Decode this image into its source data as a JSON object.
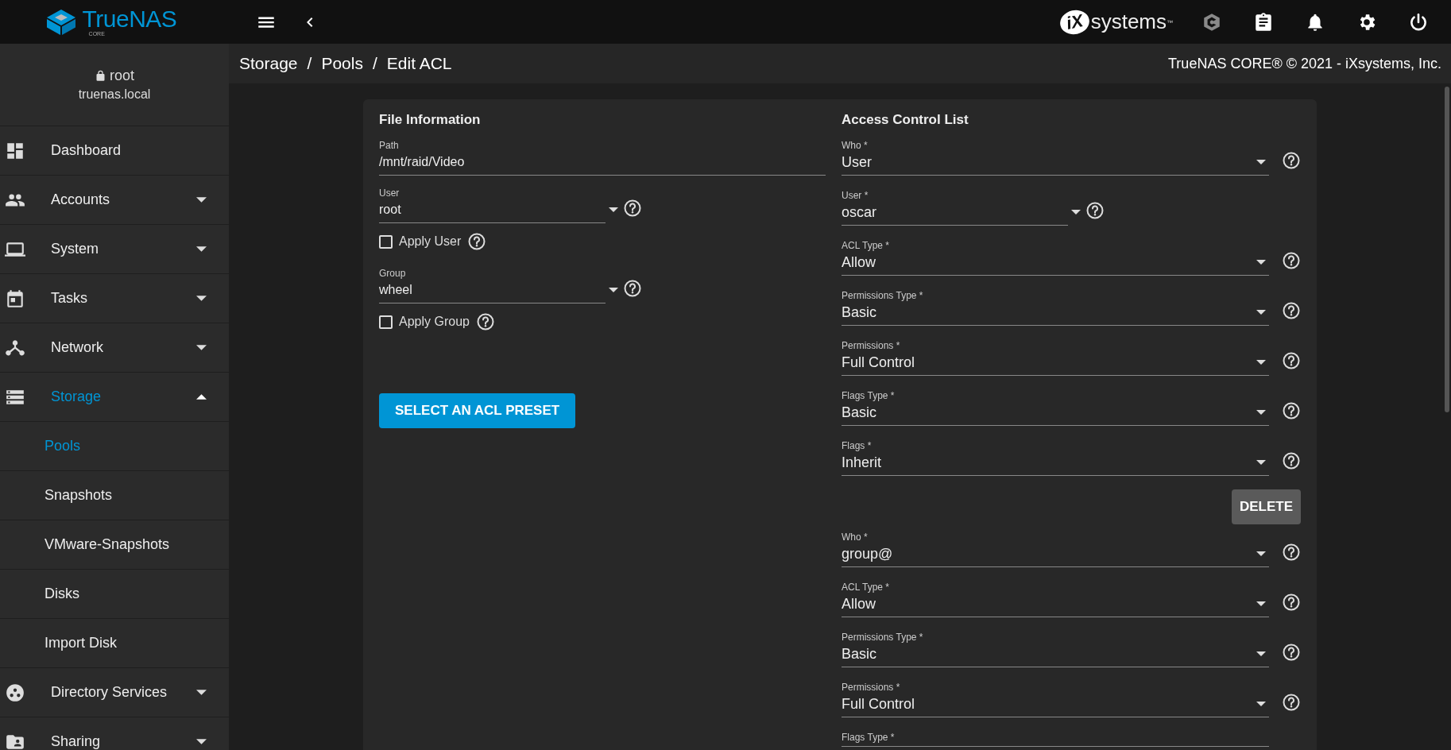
{
  "topbar": {
    "logo_name": "TrueNAS",
    "logo_sub": "CORE",
    "vendor_mark": "iX",
    "vendor_name": "systems",
    "vendor_tm": "™"
  },
  "sidebar": {
    "user": "root",
    "host": "truenas.local",
    "items": [
      {
        "label": "Dashboard",
        "selected": false
      },
      {
        "label": "Accounts",
        "selected": false,
        "expanded": false
      },
      {
        "label": "System",
        "selected": false,
        "expanded": false
      },
      {
        "label": "Tasks",
        "selected": false,
        "expanded": false
      },
      {
        "label": "Network",
        "selected": false,
        "expanded": false
      },
      {
        "label": "Storage",
        "selected": true,
        "expanded": true,
        "children": [
          {
            "label": "Pools",
            "selected": true
          },
          {
            "label": "Snapshots",
            "selected": false
          },
          {
            "label": "VMware-Snapshots",
            "selected": false
          },
          {
            "label": "Disks",
            "selected": false
          },
          {
            "label": "Import Disk",
            "selected": false
          }
        ]
      },
      {
        "label": "Directory Services",
        "selected": false,
        "expanded": false
      },
      {
        "label": "Sharing",
        "selected": false,
        "expanded": false
      }
    ]
  },
  "breadcrumb": {
    "items": [
      "Storage",
      "Pools",
      "Edit ACL"
    ],
    "separator": "/"
  },
  "copyright": "TrueNAS CORE® © 2021 - iXsystems, Inc.",
  "file_information": {
    "title": "File Information",
    "path": {
      "label": "Path",
      "value": "/mnt/raid/Video"
    },
    "user": {
      "label": "User",
      "value": "root"
    },
    "apply_user": {
      "label": "Apply User",
      "checked": false
    },
    "group": {
      "label": "Group",
      "value": "wheel"
    },
    "apply_group": {
      "label": "Apply Group",
      "checked": false
    },
    "preset_button": "SELECT AN ACL PRESET"
  },
  "access_control_list": {
    "title": "Access Control List",
    "entries": [
      {
        "fields": [
          {
            "kind": "select",
            "label": "Who *",
            "value": "User"
          },
          {
            "kind": "short-select",
            "label": "User *",
            "value": "oscar"
          },
          {
            "kind": "select",
            "label": "ACL Type *",
            "value": "Allow"
          },
          {
            "kind": "select",
            "label": "Permissions Type *",
            "value": "Basic"
          },
          {
            "kind": "select",
            "label": "Permissions *",
            "value": "Full Control"
          },
          {
            "kind": "select",
            "label": "Flags Type *",
            "value": "Basic"
          },
          {
            "kind": "select",
            "label": "Flags *",
            "value": "Inherit"
          }
        ],
        "delete_button": "DELETE"
      },
      {
        "fields": [
          {
            "kind": "select",
            "label": "Who *",
            "value": "group@"
          },
          {
            "kind": "select",
            "label": "ACL Type *",
            "value": "Allow"
          },
          {
            "kind": "select",
            "label": "Permissions Type *",
            "value": "Basic"
          },
          {
            "kind": "select",
            "label": "Permissions *",
            "value": "Full Control"
          },
          {
            "kind": "label-only",
            "label": "Flags Type *"
          }
        ]
      }
    ]
  }
}
